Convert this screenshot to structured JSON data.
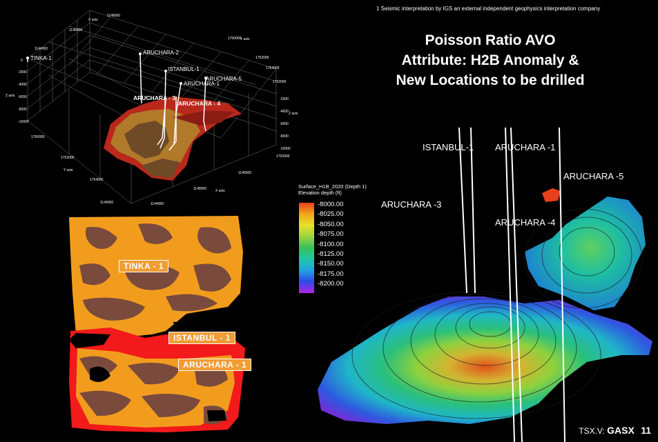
{
  "footnote": "1 Seismic interpretation by IGS an external independent geophysics interpretation company",
  "title": {
    "line1": "Poisson Ratio AVO",
    "line2": "Attribute: H2B Anomaly &",
    "line3": "New Locations to be drilled"
  },
  "cube_view": {
    "axes": {
      "x": "X axis",
      "y": "Y axis",
      "z": "Z axis"
    },
    "x_ticks": [
      "1144000",
      "1146000",
      "1148000"
    ],
    "y_ticks_top": [
      "1750000",
      "1752000",
      "1754000"
    ],
    "z_ticks": [
      "0",
      "-2000",
      "-4000",
      "-6000",
      "-8000",
      "-10000"
    ],
    "bottom_ticks": [
      "1148000",
      "1146000",
      "1144000"
    ],
    "left_y_ticks": [
      "1750000",
      "1752000",
      "1754000"
    ],
    "right_y_ticks": [
      "1752000",
      "1754000",
      "1756000"
    ],
    "right_z_ticks": [
      "-2000",
      "-4000",
      "-6000",
      "-8000",
      "-10000"
    ],
    "wells": [
      "TINKA-1",
      "ARUCHARA-2",
      "ISTANBUL-1",
      "ARUCHARA-5",
      "ARUCHARA-1",
      "ARUCHARA - 3",
      "ARUCHARA - 4"
    ]
  },
  "attribute_map": {
    "labels": [
      "TINKA - 1",
      "ISTANBUL - 1",
      "ARUCHARA - 1"
    ]
  },
  "surface_view": {
    "wells": [
      "ISTANBUL-1",
      "ARUCHARA -1",
      "ARUCHARA -5",
      "ARUCHARA -3",
      "ARUCHARA -4"
    ],
    "legend": {
      "title_line1": "Surface_H1B_2020 (Depth 1)",
      "title_line2": "Elevation depth (ft)",
      "ticks": [
        "-8000.00",
        "-8025.00",
        "-8050.00",
        "-8075.00",
        "-8100.00",
        "-8125.00",
        "-8150.00",
        "-8175.00",
        "-8200.00"
      ]
    }
  },
  "footer": {
    "prefix": "TSX.V:",
    "ticker": "GASX",
    "page": "11"
  }
}
